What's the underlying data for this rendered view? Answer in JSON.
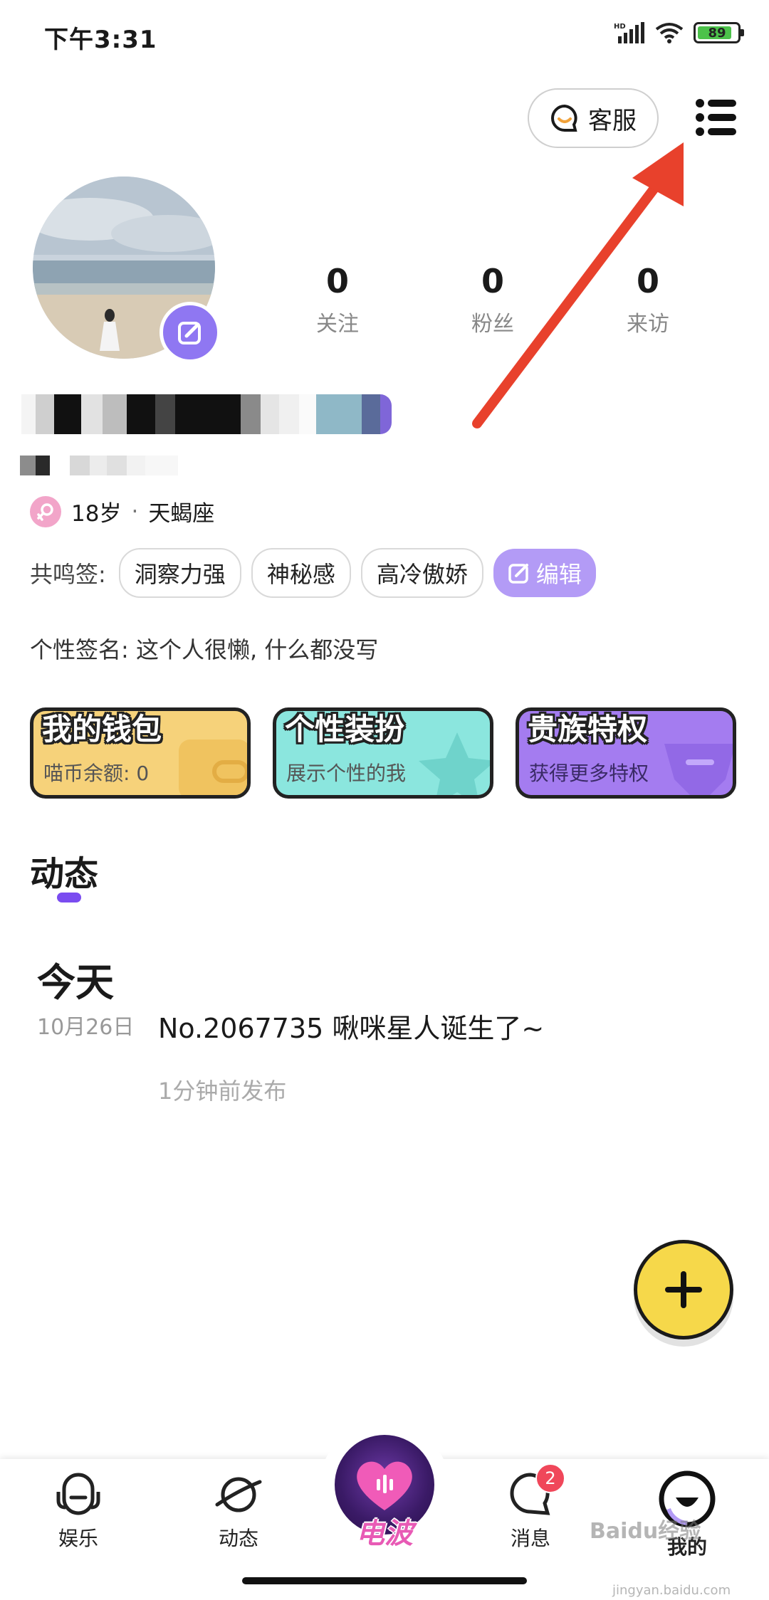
{
  "status_bar": {
    "time": "下午3:31",
    "battery": "89"
  },
  "header": {
    "service_label": "客服"
  },
  "stats": [
    {
      "value": "0",
      "label": "关注"
    },
    {
      "value": "0",
      "label": "粉丝"
    },
    {
      "value": "0",
      "label": "来访"
    }
  ],
  "profile": {
    "age": "18岁",
    "separator": "·",
    "zodiac": "天蝎座"
  },
  "tags": {
    "title": "共鸣签:",
    "items": [
      "洞察力强",
      "神秘感",
      "高冷傲娇"
    ],
    "edit_label": "编辑"
  },
  "signature": "个性签名: 这个人很懒, 什么都没写",
  "cards": [
    {
      "title": "我的钱包",
      "subtitle": "喵币余额: 0",
      "color": "#f6d27a"
    },
    {
      "title": "个性装扮",
      "subtitle": "展示个性的我",
      "color": "#8be6de"
    },
    {
      "title": "贵族特权",
      "subtitle": "获得更多特权",
      "color": "#a47cf0"
    }
  ],
  "feed": {
    "section_title": "动态",
    "day_label": "今天",
    "date": "10月26日",
    "post_text": "No.2067735 啾咪星人诞生了~",
    "post_time": "1分钟前发布"
  },
  "bottom_nav": {
    "items": [
      {
        "label": "娱乐",
        "icon": "entertainment-icon"
      },
      {
        "label": "动态",
        "icon": "planet-icon"
      },
      {
        "label": "电波",
        "icon": "heart-wave-icon"
      },
      {
        "label": "消息",
        "icon": "message-icon",
        "badge": "2"
      },
      {
        "label": "我的",
        "icon": "profile-face-icon"
      }
    ]
  },
  "watermark": {
    "text": "Baidu经验",
    "url": "jingyan.baidu.com"
  },
  "colors": {
    "accent_purple": "#8f77f2",
    "fab_yellow": "#f6d84a",
    "arrow_red": "#e8412c"
  }
}
